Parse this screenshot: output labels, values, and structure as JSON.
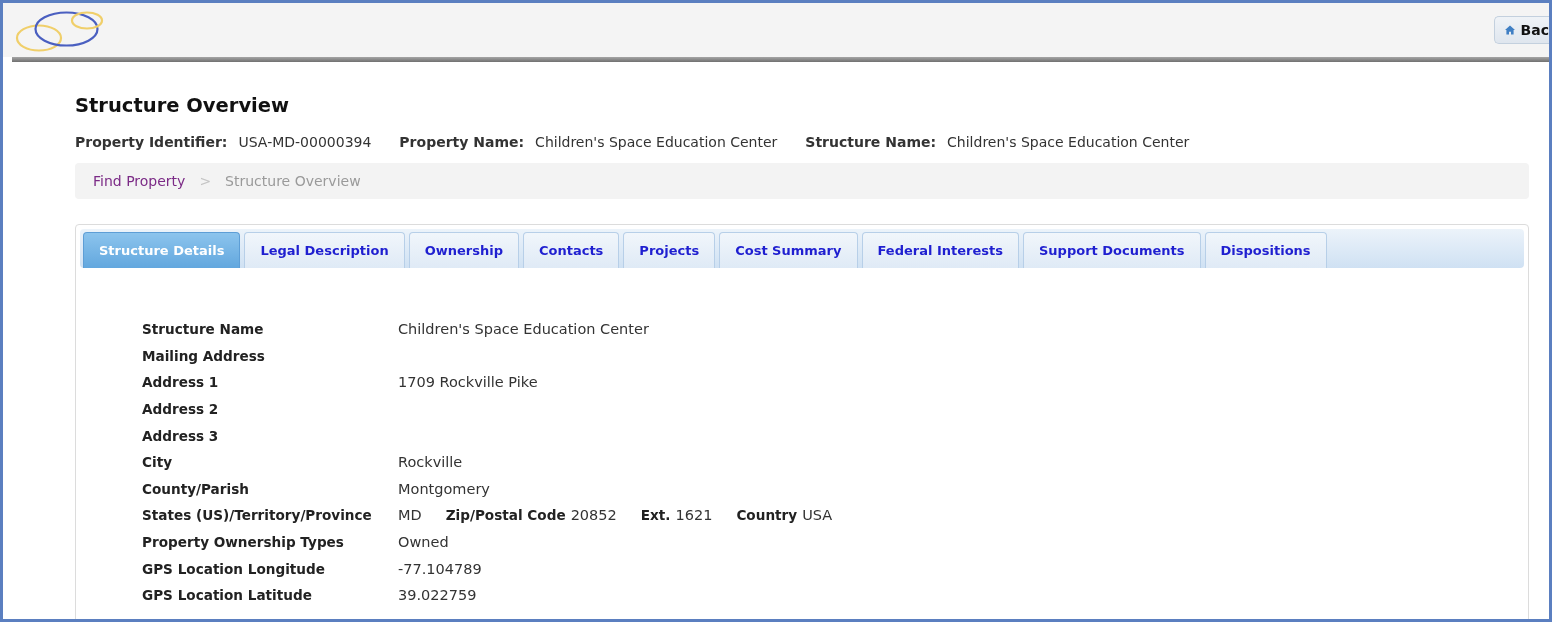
{
  "header": {
    "back_button": {
      "label": "Bac"
    }
  },
  "page": {
    "title": "Structure Overview"
  },
  "summary": [
    {
      "label": "Property Identifier:",
      "value": "USA-MD-00000394"
    },
    {
      "label": "Property Name:",
      "value": "Children's Space Education Center"
    },
    {
      "label": "Structure Name:",
      "value": "Children's Space Education Center"
    }
  ],
  "breadcrumb": {
    "separator": ">",
    "items": [
      {
        "label": "Find Property",
        "current": false
      },
      {
        "label": "Structure Overview",
        "current": true
      }
    ]
  },
  "tabs": [
    {
      "label": "Structure Details",
      "selected": true
    },
    {
      "label": "Legal Description",
      "selected": false
    },
    {
      "label": "Ownership",
      "selected": false
    },
    {
      "label": "Contacts",
      "selected": false
    },
    {
      "label": "Projects",
      "selected": false
    },
    {
      "label": "Cost Summary",
      "selected": false
    },
    {
      "label": "Federal Interests",
      "selected": false
    },
    {
      "label": "Support Documents",
      "selected": false
    },
    {
      "label": "Dispositions",
      "selected": false
    }
  ],
  "details": [
    {
      "label": "Structure Name",
      "value": "Children's Space Education Center"
    },
    {
      "label": "Mailing Address"
    },
    {
      "label": "Address 1",
      "value": "1709 Rockville Pike"
    },
    {
      "label": "Address 2"
    },
    {
      "label": "Address 3"
    },
    {
      "label": "City",
      "value": "Rockville"
    },
    {
      "label": "County/Parish",
      "value": "Montgomery"
    },
    {
      "label": "States (US)/Territory/Province",
      "value": "MD",
      "extras": [
        {
          "label": "Zip/Postal Code",
          "value": "20852"
        },
        {
          "label": "Ext.",
          "value": "1621"
        },
        {
          "label": "Country",
          "value": "USA"
        }
      ]
    },
    {
      "label": "Property Ownership Types",
      "value": "Owned"
    },
    {
      "label": "GPS Location Longitude",
      "value": "-77.104789"
    },
    {
      "label": "GPS Location Latitude",
      "value": "39.022759"
    }
  ]
}
